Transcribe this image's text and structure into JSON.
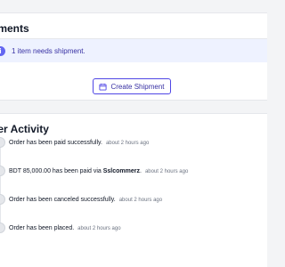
{
  "shipments": {
    "title": "pments",
    "alert_icon": "info-icon",
    "alert_text": "1 item needs shipment.",
    "button_label": "Create Shipment",
    "button_icon": "calendar-icon"
  },
  "activity": {
    "title": "der Activity",
    "items": [
      {
        "text": "Order has been paid successfully.",
        "highlight": "",
        "time": "about 2 hours ago"
      },
      {
        "text": "BDT 85,000.00 has been paid via ",
        "highlight": "Sslcommerz",
        "suffix": ".",
        "time": "about 2 hours ago"
      },
      {
        "text": "Order has been canceled successfully.",
        "highlight": "",
        "time": "about 2 hours ago"
      },
      {
        "text": "Order has been placed.",
        "highlight": "",
        "time": "about 2 hours ago"
      }
    ]
  },
  "colors": {
    "accent": "#4f46e5",
    "alert_bg": "#eef2ff",
    "page_bg": "#f3f4f6"
  }
}
